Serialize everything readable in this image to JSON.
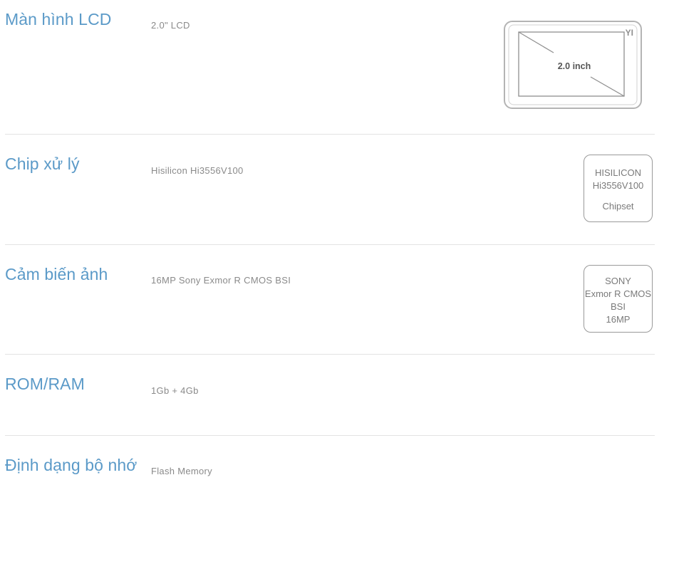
{
  "specs": [
    {
      "title": "Màn hình LCD",
      "value": "2.0\" LCD",
      "graphic": {
        "brand": "YI",
        "screen_label": "2.0 inch"
      }
    },
    {
      "title": "Chip xử lý",
      "value": "Hisilicon Hi3556V100",
      "graphic": {
        "line1": "HISILICON",
        "line2": "Hi3556V100",
        "line3": "Chipset"
      }
    },
    {
      "title": "Cảm biến ảnh",
      "value": "16MP Sony Exmor R CMOS BSI",
      "graphic": {
        "line1": "SONY",
        "line2": "Exmor R CMOS",
        "line3": "BSI",
        "line4": "16MP"
      }
    },
    {
      "title": "ROM/RAM",
      "value": "1Gb + 4Gb"
    },
    {
      "title": "Định dạng bộ nhớ",
      "value": "Flash Memory"
    }
  ],
  "colors": {
    "title": "#5b9ac8",
    "value": "#8a8a8a",
    "divider": "#e3e3e3",
    "graphic_stroke": "#9a9a9a"
  }
}
